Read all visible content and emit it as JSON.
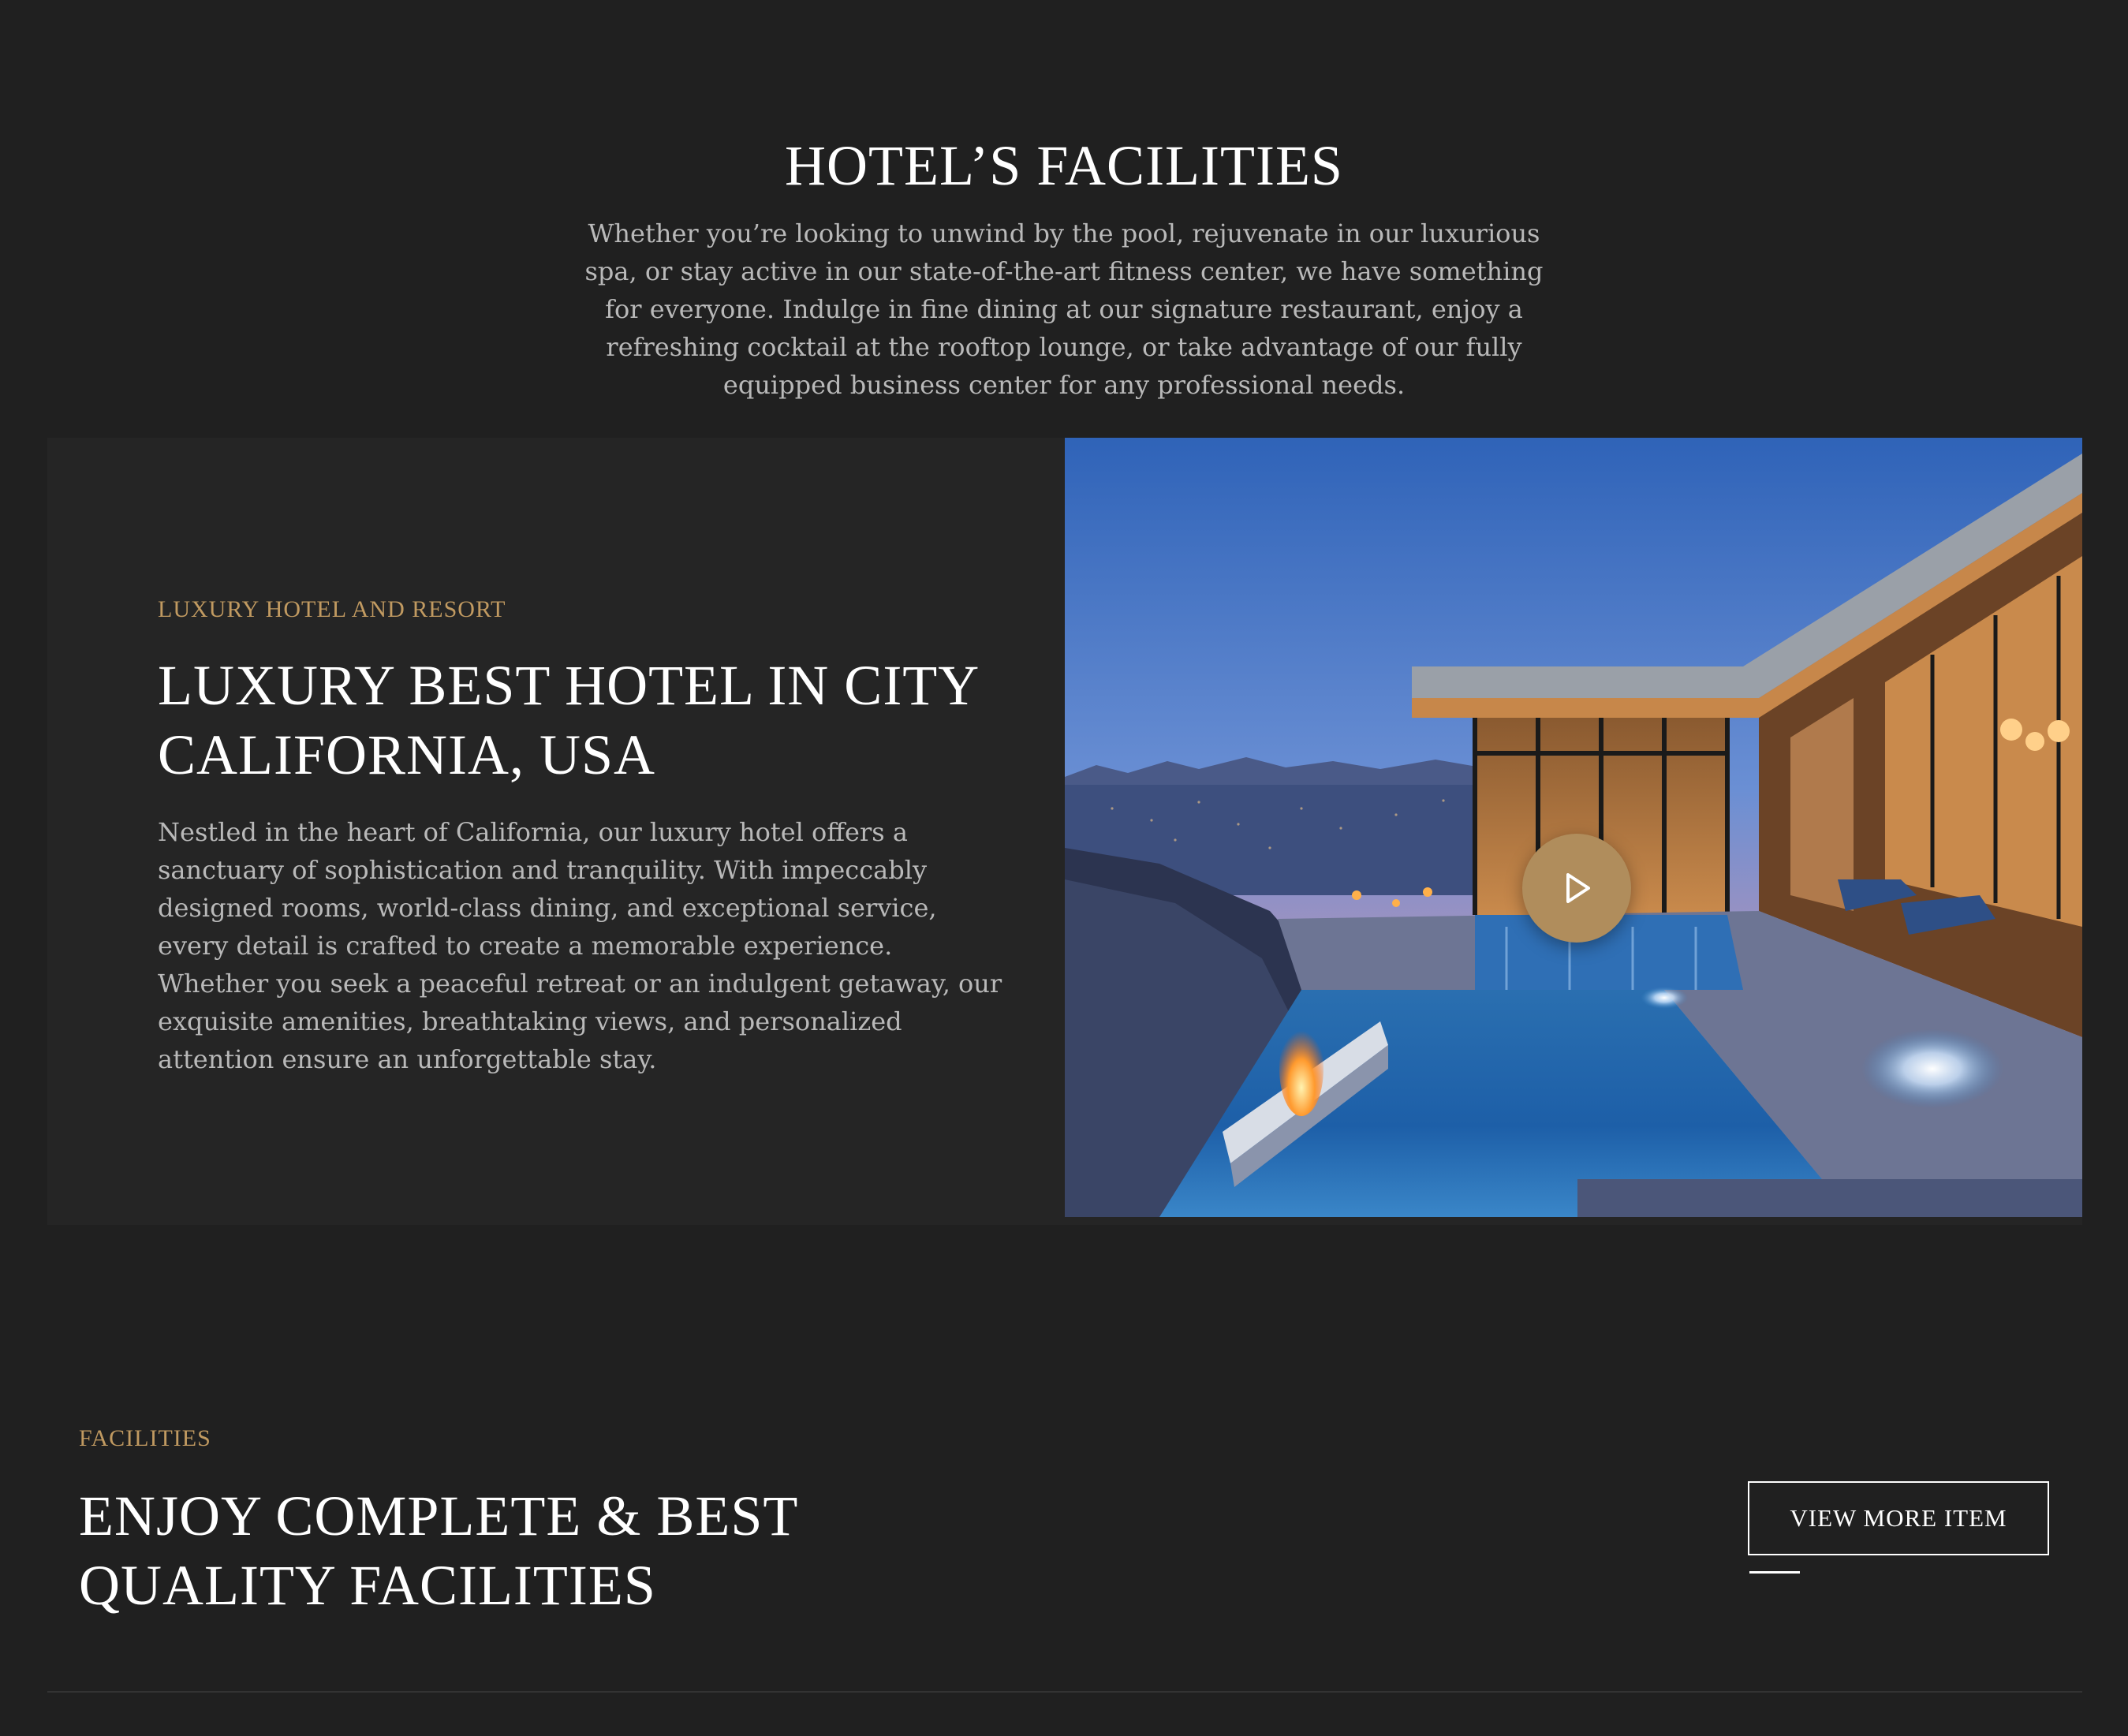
{
  "intro": {
    "title": "HOTEL’S FACILITIES",
    "description": "Whether you’re looking to unwind by the pool, rejuvenate in our luxurious spa, or stay active in our state-of-the-art fitness center, we have something for everyone. Indulge in fine dining at our signature restaurant, enjoy a refreshing cocktail at the rooftop lounge, or take advantage of our fully equipped business center for any professional needs."
  },
  "about": {
    "eyebrow": "LUXURY HOTEL AND RESORT",
    "title": "LUXURY BEST HOTEL IN CITY CALIFORNIA, USA",
    "description": "Nestled in the heart of California, our luxury hotel offers a sanctuary of sophistication and tranquility. With impeccably designed rooms, world-class dining, and exceptional service, every detail is crafted to create a memorable experience. Whether you seek a peaceful retreat or an indulgent getaway, our exquisite amenities, breathtaking views, and personalized attention ensure an unforgettable stay.",
    "media_icon": "play-icon"
  },
  "facilities": {
    "eyebrow": "FACILITIES",
    "title": "ENJOY COMPLETE & BEST QUALITY FACILITIES",
    "button_label": "VIEW MORE ITEM"
  },
  "colors": {
    "background": "#202020",
    "card": "#252525",
    "accent": "#c19a61",
    "play_button": "#b08d5c"
  }
}
